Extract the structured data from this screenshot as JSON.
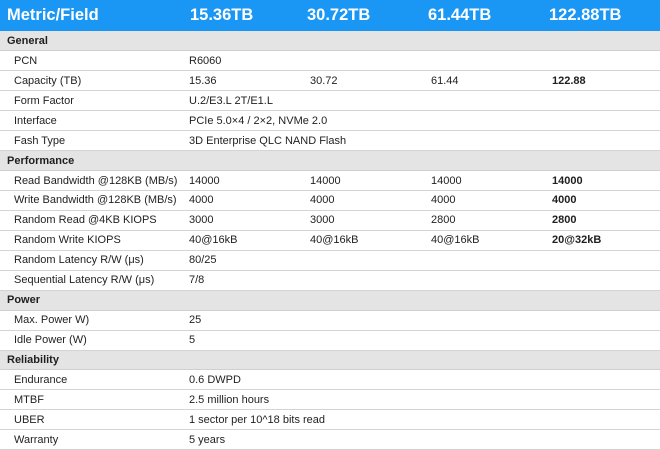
{
  "header": {
    "metric": "Metric/Field",
    "cap1": "15.36TB",
    "cap2": "30.72TB",
    "cap3": "61.44TB",
    "cap4": "122.88TB"
  },
  "colors": {
    "header_bg": "#1a97f5",
    "section_bg": "#e4e4e4"
  },
  "sections": [
    {
      "title": "General",
      "rows": [
        {
          "label": "PCN",
          "v1": "R6060",
          "v2": "",
          "v3": "",
          "v4": ""
        },
        {
          "label": "Capacity (TB)",
          "v1": "15.36",
          "v2": "30.72",
          "v3": "61.44",
          "v4": "122.88"
        },
        {
          "label": "Form Factor",
          "v1": "U.2/E3.L 2T/E1.L",
          "v2": "",
          "v3": "",
          "v4": ""
        },
        {
          "label": "Interface",
          "v1": "PCIe 5.0×4 / 2×2, NVMe 2.0",
          "v2": "",
          "v3": "",
          "v4": ""
        },
        {
          "label": "Fash Type",
          "v1": "3D Enterprise QLC NAND Flash",
          "v2": "",
          "v3": "",
          "v4": ""
        }
      ]
    },
    {
      "title": "Performance",
      "rows": [
        {
          "label": "Read Bandwidth @128KB (MB/s)",
          "v1": "14000",
          "v2": "14000",
          "v3": "14000",
          "v4": "14000"
        },
        {
          "label": "Write Bandwidth @128KB (MB/s)",
          "v1": "4000",
          "v2": "4000",
          "v3": "4000",
          "v4": "4000"
        },
        {
          "label": "Random Read @4KB KIOPS",
          "v1": "3000",
          "v2": "3000",
          "v3": "2800",
          "v4": "2800"
        },
        {
          "label": "Random Write KIOPS",
          "v1": "40@16kB",
          "v2": "40@16kB",
          "v3": "40@16kB",
          "v4": "20@32kB"
        },
        {
          "label": "Random Latency R/W (μs)",
          "v1": "80/25",
          "v2": "",
          "v3": "",
          "v4": ""
        },
        {
          "label": "Sequential Latency R/W (μs)",
          "v1": "7/8",
          "v2": "",
          "v3": "",
          "v4": ""
        }
      ]
    },
    {
      "title": "Power",
      "rows": [
        {
          "label": "Max. Power W)",
          "v1": "25",
          "v2": "",
          "v3": "",
          "v4": ""
        },
        {
          "label": "Idle Power (W)",
          "v1": "5",
          "v2": "",
          "v3": "",
          "v4": ""
        }
      ]
    },
    {
      "title": "Reliability",
      "rows": [
        {
          "label": "Endurance",
          "v1": "0.6 DWPD",
          "v2": "",
          "v3": "",
          "v4": ""
        },
        {
          "label": "MTBF",
          "v1": "2.5 million hours",
          "v2": "",
          "v3": "",
          "v4": ""
        },
        {
          "label": "UBER",
          "v1": "1 sector per 10^18 bits read",
          "v2": "",
          "v3": "",
          "v4": ""
        },
        {
          "label": "Warranty",
          "v1": "5 years",
          "v2": "",
          "v3": "",
          "v4": ""
        }
      ]
    }
  ]
}
